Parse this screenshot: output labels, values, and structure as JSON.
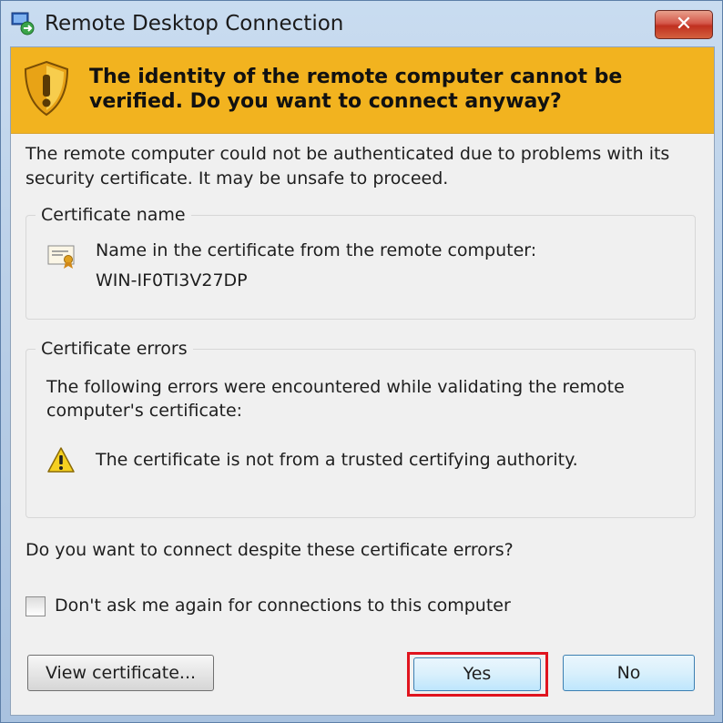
{
  "window": {
    "title": "Remote Desktop Connection",
    "close_label": "✕"
  },
  "banner": {
    "heading": "The identity of the remote computer cannot be verified. Do you want to connect anyway?",
    "icon": "shield-warning-icon",
    "background": "#f2b31f"
  },
  "intro": "The remote computer could not be authenticated due to problems with its security certificate. It may be unsafe to proceed.",
  "certificate_name": {
    "label": "Certificate name",
    "description": "Name in the certificate from the remote computer:",
    "value": "WIN-IF0TI3V27DP",
    "icon": "certificate-icon"
  },
  "certificate_errors": {
    "label": "Certificate errors",
    "description": "The following errors were encountered while validating the remote computer's certificate:",
    "items": [
      {
        "text": "The certificate is not from a trusted certifying authority.",
        "icon": "warning-icon"
      }
    ]
  },
  "question": "Do you want to connect despite these certificate errors?",
  "dont_ask": {
    "label": "Don't ask me again for connections to this computer",
    "checked": false
  },
  "buttons": {
    "view_certificate": "View certificate...",
    "yes": "Yes",
    "no": "No"
  },
  "highlight_color": "#e0141e"
}
